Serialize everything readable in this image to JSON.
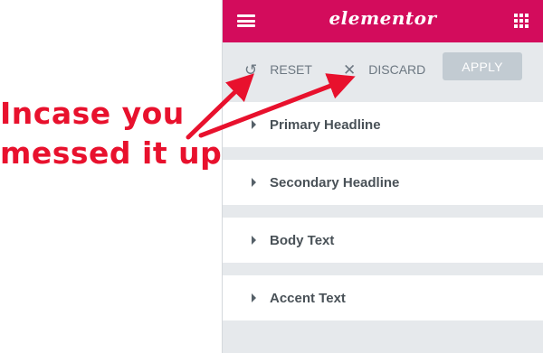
{
  "annotation": {
    "line1": "Incase you",
    "line2": "messed it up"
  },
  "header": {
    "logo": "elementor",
    "menu_icon": "hamburger-icon",
    "apps_icon": "grid-icon",
    "color": "#d30c5c"
  },
  "actions": {
    "reset_label": "RESET",
    "discard_label": "DISCARD",
    "apply_label": "APPLY",
    "reset_icon": "undo-icon",
    "discard_icon": "close-icon"
  },
  "sections": [
    {
      "label": "Primary Headline"
    },
    {
      "label": "Secondary Headline"
    },
    {
      "label": "Body Text"
    },
    {
      "label": "Accent Text"
    }
  ],
  "colors": {
    "annotation_red": "#e8112d",
    "brand": "#d30c5c",
    "panel_bg": "#e6e9ec"
  }
}
